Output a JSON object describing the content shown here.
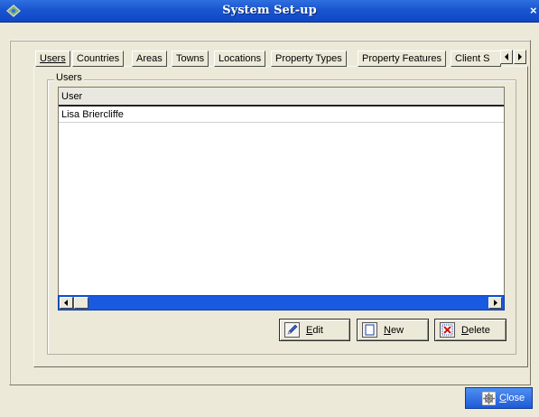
{
  "window": {
    "title": "System Set-up",
    "close_glyph": "×"
  },
  "tabs": [
    {
      "label": "Users",
      "active": true
    },
    {
      "label": "Countries"
    },
    {
      "label": "Areas"
    },
    {
      "label": "Towns"
    },
    {
      "label": "Locations"
    },
    {
      "label": "Property Types"
    },
    {
      "label": "Property Features"
    },
    {
      "label": "Client S"
    }
  ],
  "tab_scroll": {
    "left_glyph": "◂",
    "right_glyph": "▸"
  },
  "users_group": {
    "legend": "Users",
    "columns": [
      "User"
    ],
    "rows": [
      "Lisa Briercliffe"
    ]
  },
  "buttons": {
    "edit_prefix": "",
    "edit_hotkey": "E",
    "edit_rest": "dit",
    "new_hotkey": "N",
    "new_rest": "ew",
    "delete_hotkey": "D",
    "delete_rest": "elete",
    "close_hotkey": "C",
    "close_rest": "lose"
  },
  "colors": {
    "titlebar": "#1a55d0",
    "window_bg": "#ece9d8",
    "scrollbar": "#1a5ae0",
    "close_button": "#1d5bd8"
  },
  "icons": {
    "app": "app-logo-icon",
    "edit": "pencil-icon",
    "new": "new-document-icon",
    "delete": "delete-x-icon",
    "close": "close-gear-icon"
  }
}
